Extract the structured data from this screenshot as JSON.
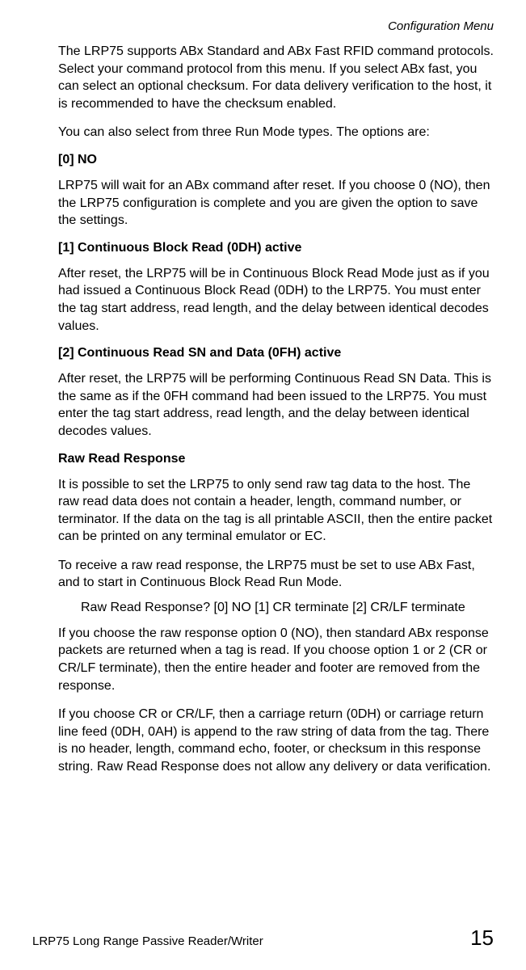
{
  "header": {
    "running": "Configuration Menu"
  },
  "content": {
    "p1": "The LRP75 supports ABx Standard and ABx Fast RFID command protocols. Select your command protocol from this menu. If you select ABx fast, you can select an optional checksum. For data delivery verification to the host, it is recommended to have the checksum enabled.",
    "p2": "You can also select from three Run Mode types. The options are:",
    "h1": "[0] NO",
    "p3": "LRP75 will wait for an ABx command after reset. If you choose 0 (NO), then the LRP75 configuration is complete and you are given the option to save the settings.",
    "h2": "[1] Continuous Block Read (0DH) active",
    "p4": "After reset, the LRP75 will be in Continuous Block Read Mode just as if you had issued a Continuous Block Read (0DH) to the LRP75. You must enter the tag start address, read length, and the delay between identical decodes values.",
    "h3": "[2] Continuous Read SN and Data (0FH) active",
    "p5": "After reset, the LRP75 will be performing Continuous Read SN Data. This is the same as if the 0FH command had been issued to the LRP75. You must enter the tag start address, read length, and the delay between identical decodes values.",
    "h4": "Raw Read Response",
    "p6": "It is possible to set the LRP75 to only send raw tag data to the host. The raw read data does not contain a header, length, command number, or terminator. If the data on the tag is all printable ASCII, then the entire packet can be printed on any terminal emulator or EC.",
    "p7": "To receive a raw read response, the LRP75 must be set to use ABx Fast, and to start in Continuous Block Read Run Mode.",
    "indent1": "Raw Read Response? [0] NO [1] CR terminate [2] CR/LF terminate",
    "p8": "If you choose the raw response option 0 (NO), then standard ABx response packets are returned when a tag is read. If you choose option 1 or 2 (CR or CR/LF terminate), then the entire header and footer are removed from the response.",
    "p9": "If you choose CR or CR/LF, then a carriage return (0DH) or carriage return line feed (0DH, 0AH) is append to the raw string of data from the tag. There is no header, length, command echo, footer, or checksum in this response string. Raw Read Response does not allow any delivery or data verification."
  },
  "footer": {
    "left": "LRP75 Long Range Passive Reader/Writer",
    "right": "15"
  }
}
